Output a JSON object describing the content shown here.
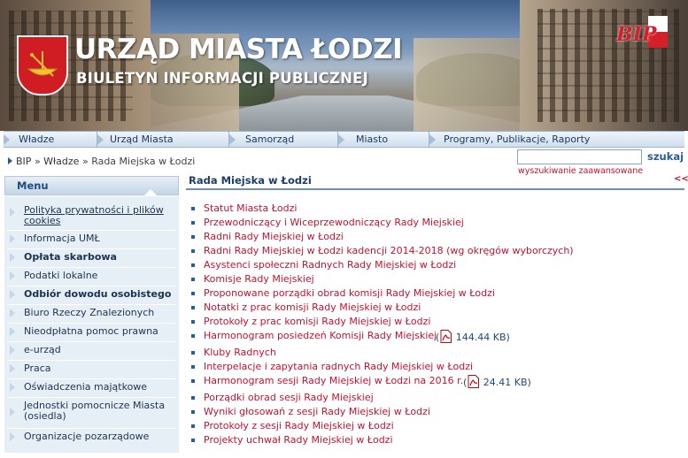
{
  "header": {
    "title_main": "URZĄD MIASTA ŁODZI",
    "title_sub": "BIULETYN INFORMACJI PUBLICZNEJ",
    "bip_logo_text": "BIP",
    "crest_icon": "lodz-crest-boat-icon"
  },
  "topnav": {
    "items": [
      {
        "label": "Władze"
      },
      {
        "label": "Urząd Miasta"
      },
      {
        "label": "Samorząd"
      },
      {
        "label": "Miasto"
      },
      {
        "label": "Programy, Publikacje, Raporty"
      }
    ]
  },
  "breadcrumb": {
    "items": [
      "BIP",
      "Władze",
      "Rada Miejska w Łodzi"
    ],
    "separator": "»"
  },
  "search": {
    "value": "",
    "button_label": "szukaj",
    "advanced_label": "wyszukiwanie zaawansowane"
  },
  "menu": {
    "heading": "Menu",
    "items": [
      {
        "label": "Polityka prywatności i plików cookies",
        "bold": false,
        "underline": true
      },
      {
        "label": "Informacja UMŁ",
        "bold": false,
        "underline": false
      },
      {
        "label": "Opłata skarbowa",
        "bold": true,
        "underline": false
      },
      {
        "label": "Podatki lokalne",
        "bold": false,
        "underline": false
      },
      {
        "label": "Odbiór dowodu osobistego",
        "bold": true,
        "underline": false
      },
      {
        "label": "Biuro Rzeczy Znalezionych",
        "bold": false,
        "underline": false
      },
      {
        "label": "Nieodpłatna pomoc prawna",
        "bold": false,
        "underline": false
      },
      {
        "label": "e-urząd",
        "bold": false,
        "underline": false
      },
      {
        "label": "Praca",
        "bold": false,
        "underline": false
      },
      {
        "label": "Oświadczenia majątkowe",
        "bold": false,
        "underline": false
      },
      {
        "label": "Jednostki pomocnicze Miasta (osiedla)",
        "bold": false,
        "underline": false
      },
      {
        "label": "Organizacje pozarządowe",
        "bold": false,
        "underline": false
      }
    ]
  },
  "content": {
    "title": "Rada Miejska w Łodzi",
    "back_label": "<<",
    "links": [
      {
        "label": "Statut Miasta Łodzi"
      },
      {
        "label": "Przewodniczący i Wiceprzewodniczący Rady Miejskiej"
      },
      {
        "label": "Radni Rady Miejskiej w Łodzi"
      },
      {
        "label": "Radni Rady Miejskiej w Łodzi kadencji 2014-2018 (wg okręgów wyborczych)"
      },
      {
        "label": "Asystenci społeczni Radnych Rady Miejskiej w Łodzi"
      },
      {
        "label": "Komisje Rady Miejskiej"
      },
      {
        "label": "Proponowane porządki obrad komisji Rady Miejskiej w Łodzi"
      },
      {
        "label": "Notatki z prac komisji Rady Miejskiej w Łodzi"
      },
      {
        "label": "Protokoły z prac komisji Rady Miejskiej w Łodzi"
      },
      {
        "label": "Harmonogram posiedzeń Komisji Rady Miejskiej",
        "file_size": "144.44 KB"
      },
      {
        "label": "Kluby Radnych"
      },
      {
        "label": "Interpelacje i zapytania radnych Rady Miejskiej w Łodzi"
      },
      {
        "label": "Harmonogram sesji Rady Miejskiej w Łodzi na 2016 r.",
        "file_size": "24.41 KB"
      },
      {
        "label": "Porządki obrad sesji Rady Miejskiej"
      },
      {
        "label": "Wyniki głosowań z sesji Rady Miejskiej w Łodzi"
      },
      {
        "label": "Protokoły z sesji Rady Miejskiej w Łodzi"
      },
      {
        "label": "Projekty uchwał Rady Miejskiej w Łodzi"
      }
    ]
  },
  "colors": {
    "link_red": "#c8102e",
    "nav_blue": "#1a3a66",
    "menu_bg": "#e6eef6",
    "rule_blue": "#6b8fba"
  }
}
